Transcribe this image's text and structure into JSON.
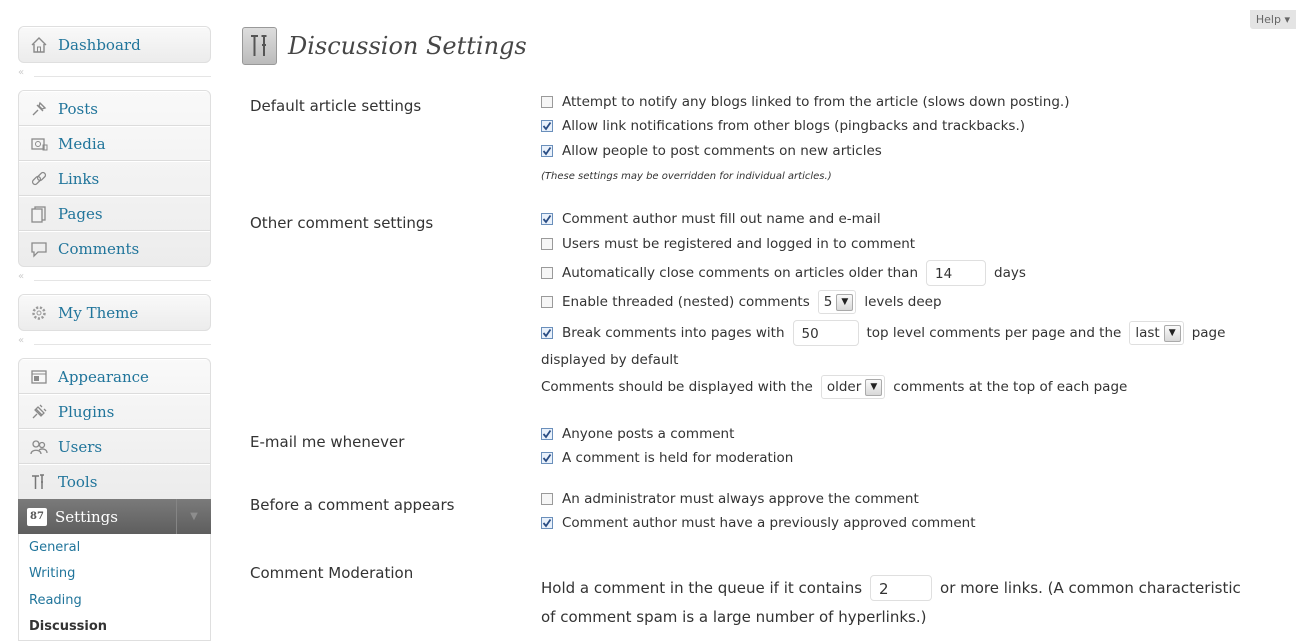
{
  "help": {
    "label": "Help ▾"
  },
  "sidebar": {
    "dashboard": "Dashboard",
    "group2": [
      "Posts",
      "Media",
      "Links",
      "Pages",
      "Comments"
    ],
    "theme": "My Theme",
    "group4": [
      "Appearance",
      "Plugins",
      "Users",
      "Tools"
    ],
    "settings": "Settings",
    "settings_icon_text": "87",
    "submenu": [
      "General",
      "Writing",
      "Reading",
      "Discussion"
    ],
    "separator_glyph": "«"
  },
  "page": {
    "title": "Discussion Settings"
  },
  "default_article": {
    "label": "Default article settings",
    "opt1": "Attempt to notify any blogs linked to from the article (slows down posting.)",
    "opt2": "Allow link notifications from other blogs (pingbacks and trackbacks.)",
    "opt3": "Allow people to post comments on new articles",
    "note": "(These settings may be overridden for individual articles.)",
    "checked": [
      false,
      true,
      true
    ]
  },
  "other_comment": {
    "label": "Other comment settings",
    "opt1": "Comment author must fill out name and e-mail",
    "opt2": "Users must be registered and logged in to comment",
    "opt3_pre": "Automatically close comments on articles older than",
    "opt3_value": "14",
    "opt3_post": "days",
    "opt4_pre": "Enable threaded (nested) comments",
    "opt4_value": "5",
    "opt4_post": "levels deep",
    "opt5_pre": "Break comments into pages with",
    "opt5_value": "50",
    "opt5_mid": "top level comments per page and the",
    "opt5_select": "last",
    "opt5_post": "page",
    "opt5_wrap": "displayed by default",
    "opt6_pre": "Comments should be displayed with the",
    "opt6_select": "older",
    "opt6_post": "comments at the top of each page",
    "checked": [
      true,
      false,
      false,
      false,
      true
    ]
  },
  "email": {
    "label": "E-mail me whenever",
    "opt1": "Anyone posts a comment",
    "opt2": "A comment is held for moderation",
    "checked": [
      true,
      true
    ]
  },
  "before": {
    "label": "Before a comment appears",
    "opt1": "An administrator must always approve the comment",
    "opt2": "Comment author must have a previously approved comment",
    "checked": [
      false,
      true
    ]
  },
  "moderation": {
    "label": "Comment Moderation",
    "pre": "Hold a comment in the queue if it contains",
    "value": "2",
    "post": "or more links. (A common characteristic",
    "wrap": "of comment spam is a large number of hyperlinks.)"
  },
  "colors": {
    "link": "#21759b",
    "settings_bg": "#6a6a6a",
    "text": "#333333"
  }
}
